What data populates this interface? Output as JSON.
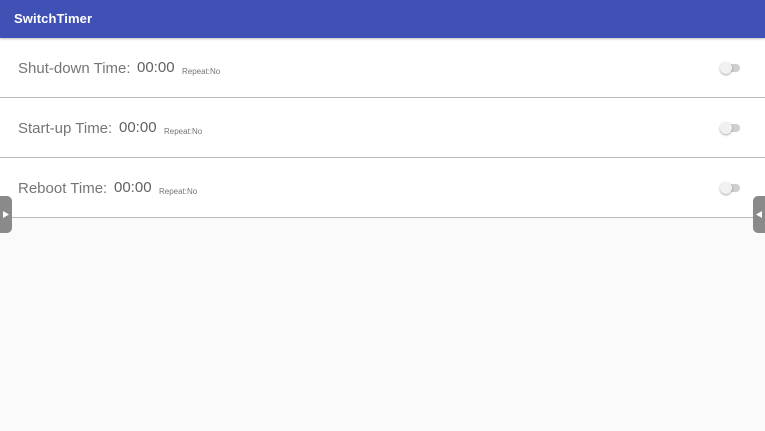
{
  "app_bar": {
    "title": "SwitchTimer",
    "color": "#3f51b5"
  },
  "timers": [
    {
      "label": "Shut-down Time:",
      "time": "00:00",
      "repeat": "Repeat:No",
      "enabled": false
    },
    {
      "label": "Start-up Time:",
      "time": "00:00",
      "repeat": "Repeat:No",
      "enabled": false
    },
    {
      "label": "Reboot Time:",
      "time": "00:00",
      "repeat": "Repeat:No",
      "enabled": false
    }
  ],
  "side_handles": {
    "left_icon": "triangle-right-icon",
    "right_icon": "triangle-left-icon"
  }
}
